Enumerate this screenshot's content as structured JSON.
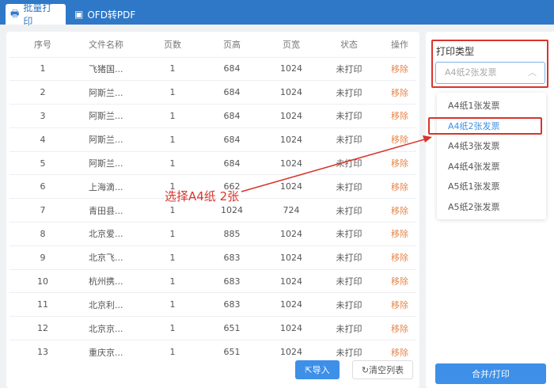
{
  "tabs": [
    {
      "label": "批量打印",
      "icon": "printer-icon"
    },
    {
      "label": "OFD转PDF",
      "icon": "file-icon"
    }
  ],
  "table": {
    "headers": [
      "序号",
      "文件名称",
      "页数",
      "页高",
      "页宽",
      "状态",
      "操作"
    ],
    "rows": [
      [
        "1",
        "飞猪国...",
        "1",
        "684",
        "1024",
        "未打印",
        "移除"
      ],
      [
        "2",
        "阿斯兰...",
        "1",
        "684",
        "1024",
        "未打印",
        "移除"
      ],
      [
        "3",
        "阿斯兰...",
        "1",
        "684",
        "1024",
        "未打印",
        "移除"
      ],
      [
        "4",
        "阿斯兰...",
        "1",
        "684",
        "1024",
        "未打印",
        "移除"
      ],
      [
        "5",
        "阿斯兰...",
        "1",
        "684",
        "1024",
        "未打印",
        "移除"
      ],
      [
        "6",
        "上海滴...",
        "1",
        "662",
        "1024",
        "未打印",
        "移除"
      ],
      [
        "7",
        "青田县...",
        "1",
        "1024",
        "724",
        "未打印",
        "移除"
      ],
      [
        "8",
        "北京爱...",
        "1",
        "885",
        "1024",
        "未打印",
        "移除"
      ],
      [
        "9",
        "北京飞...",
        "1",
        "683",
        "1024",
        "未打印",
        "移除"
      ],
      [
        "10",
        "杭州携...",
        "1",
        "683",
        "1024",
        "未打印",
        "移除"
      ],
      [
        "11",
        "北京利...",
        "1",
        "683",
        "1024",
        "未打印",
        "移除"
      ],
      [
        "12",
        "北京京...",
        "1",
        "651",
        "1024",
        "未打印",
        "移除"
      ],
      [
        "13",
        "重庆京...",
        "1",
        "651",
        "1024",
        "未打印",
        "移除"
      ]
    ]
  },
  "buttons": {
    "import": "导入",
    "clear": "清空列表",
    "merge": "合并/打印"
  },
  "print_type": {
    "label": "打印类型",
    "value": "A4纸2张发票",
    "options": [
      "A4纸1张发票",
      "A4纸2张发票",
      "A4纸3张发票",
      "A4纸4张发票",
      "A5纸1张发票",
      "A5纸2张发票"
    ],
    "selected_index": 1
  },
  "annotation": {
    "text": "选择A4纸 2张",
    "color": "#d9342b"
  }
}
